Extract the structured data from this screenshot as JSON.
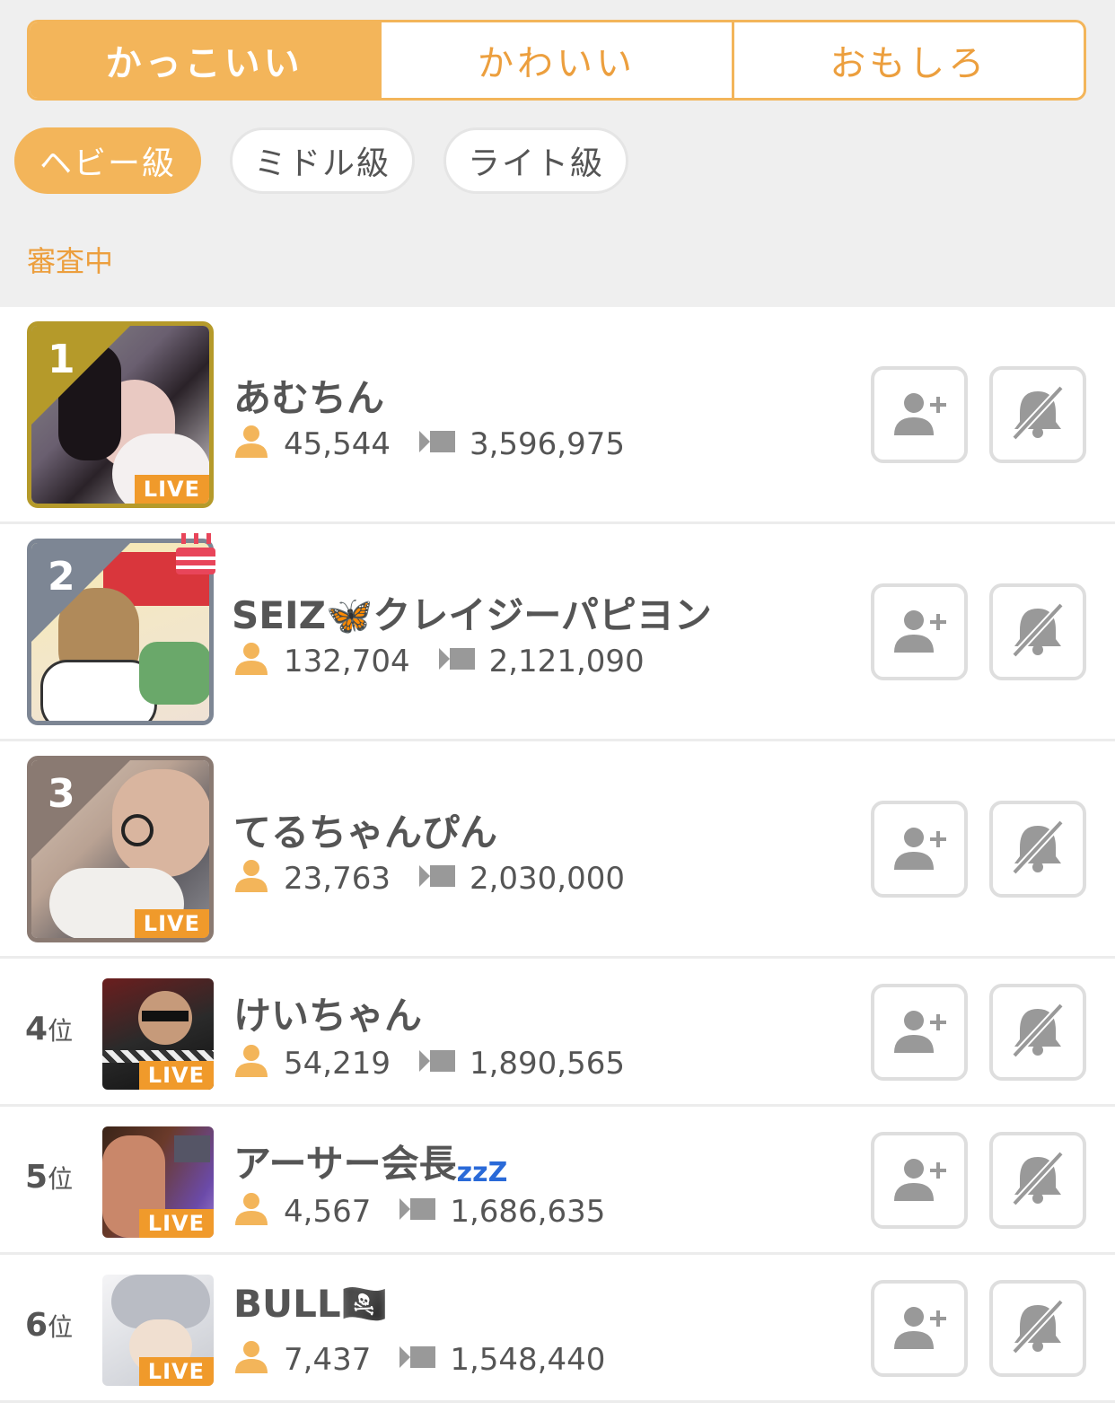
{
  "tabs": [
    {
      "label": "かっこいい",
      "active": true
    },
    {
      "label": "かわいい",
      "active": false
    },
    {
      "label": "おもしろ",
      "active": false
    }
  ],
  "weight_classes": [
    {
      "label": "ヘビー級",
      "active": true
    },
    {
      "label": "ミドル級",
      "active": false
    },
    {
      "label": "ライト級",
      "active": false
    }
  ],
  "status_label": "審査中",
  "colors": {
    "accent": "#f3b55a",
    "accent_text": "#ec9f3e",
    "live": "#f09a2b",
    "gold": "#b59a2a",
    "silver": "#7d8694",
    "bronze": "#8a7a72"
  },
  "rankings": [
    {
      "rank": "1",
      "name": "あむちん",
      "followers": "45,544",
      "views": "3,596,975",
      "live": true
    },
    {
      "rank": "2",
      "name": "SEIZ🦋クレイジーパピヨン",
      "followers": "132,704",
      "views": "2,121,090",
      "live": false
    },
    {
      "rank": "3",
      "name": "てるちゃんぴん",
      "followers": "23,763",
      "views": "2,030,000",
      "live": true
    },
    {
      "rank": "4",
      "rank_suffix": "位",
      "name": "けいちゃん",
      "followers": "54,219",
      "views": "1,890,565",
      "live": true
    },
    {
      "rank": "5",
      "rank_suffix": "位",
      "name": "アーサー会長",
      "name_suffix": "zzZ",
      "followers": "4,567",
      "views": "1,686,635",
      "live": true
    },
    {
      "rank": "6",
      "rank_suffix": "位",
      "name": "BULL🏴‍☠️",
      "followers": "7,437",
      "views": "1,548,440",
      "live": true
    }
  ],
  "live_label": "LIVE",
  "icons": {
    "followers": "person-icon",
    "views": "video-icon",
    "follow_button": "add-user-icon",
    "notify_button": "bell-off-icon"
  }
}
